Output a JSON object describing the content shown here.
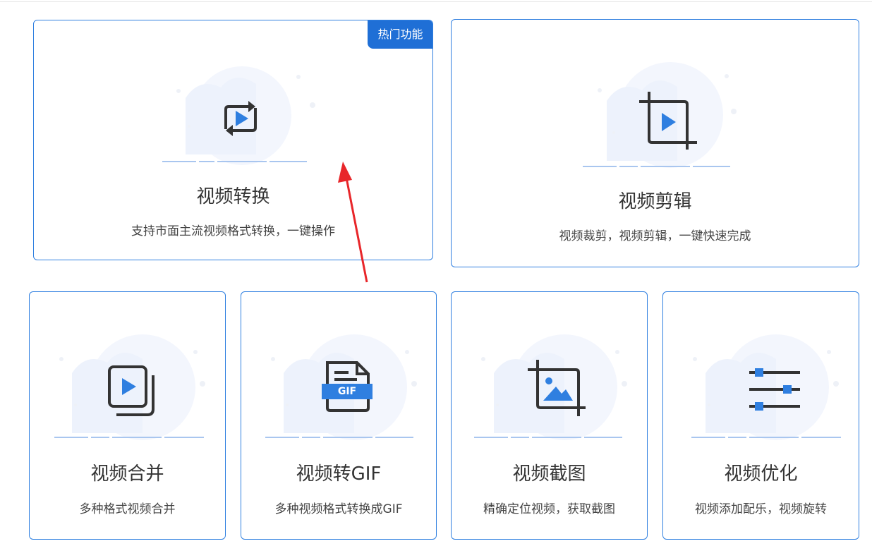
{
  "cards": [
    {
      "title": "视频转换",
      "desc": "支持市面主流视频格式转换，一键操作",
      "badge": "热门功能",
      "icon": "convert-video-icon"
    },
    {
      "title": "视频剪辑",
      "desc": "视频裁剪，视频剪辑，一键快速完成",
      "icon": "crop-video-icon"
    },
    {
      "title": "视频合并",
      "desc": "多种格式视频合并",
      "icon": "merge-video-icon"
    },
    {
      "title": "视频转GIF",
      "desc": "多种视频格式转换成GIF",
      "icon": "gif-file-icon",
      "icon_text": "GIF"
    },
    {
      "title": "视频截图",
      "desc": "精确定位视频，获取截图",
      "icon": "screenshot-image-icon"
    },
    {
      "title": "视频优化",
      "desc": "视频添加配乐，视频旋转",
      "icon": "sliders-icon"
    }
  ],
  "colors": {
    "accent": "#2f7fe0",
    "badge": "#1f6fd6",
    "annotation_arrow": "#e8262a"
  }
}
